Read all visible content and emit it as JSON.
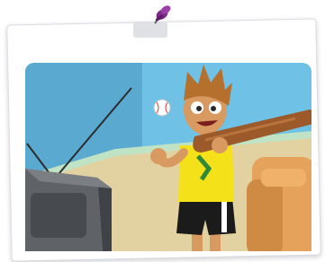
{
  "image": {
    "subject": "cartoon-boy-with-baseball-bat-and-tv",
    "colors": {
      "wall": "#6fc1e6",
      "wall_shade": "#5aa9d0",
      "floor": "#e3d2a1",
      "tv": "#5f6266",
      "tv_dark": "#3f4246",
      "shirt": "#f5e11a",
      "shorts": "#1b1b1b",
      "bat": "#9c5a2a",
      "skin": "#d99a62",
      "hair": "#b5702e",
      "chair": "#e4a25a"
    }
  }
}
